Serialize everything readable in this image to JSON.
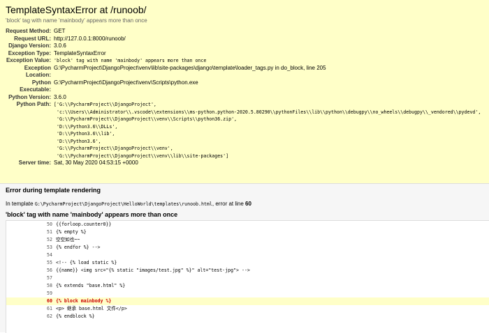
{
  "summary": {
    "title": "TemplateSyntaxError at /runoob/",
    "subtitle": "'block' tag with name 'mainbody' appears more than once",
    "rows": [
      {
        "label": "Request Method:",
        "value": "GET"
      },
      {
        "label": "Request URL:",
        "value": "http://127.0.0.1:8000/runoob/"
      },
      {
        "label": "Django Version:",
        "value": "3.0.6"
      },
      {
        "label": "Exception Type:",
        "value": "TemplateSyntaxError"
      },
      {
        "label": "Exception Value:",
        "value": "'block' tag with name 'mainbody' appears more than once"
      },
      {
        "label": "Exception Location:",
        "value": "G:\\PycharmProject\\DjangoProject\\venv\\lib\\site-packages\\django\\template\\loader_tags.py in do_block, line 205"
      },
      {
        "label": "Python Executable:",
        "value": "G:\\PycharmProject\\DjangoProject\\venv\\Scripts\\python.exe"
      },
      {
        "label": "Python Version:",
        "value": "3.6.0"
      },
      {
        "label": "Python Path:",
        "value": "['G:\\\\PycharmProject\\\\DjangoProject',\n 'c:\\\\Users\\\\Administrator\\\\.vscode\\\\extensions\\\\ms-python.python-2020.5.80290\\\\pythonFiles\\\\lib\\\\python\\\\debugpy\\\\no_wheels\\\\debugpy\\\\_vendored\\\\pydevd',\n 'G:\\\\PycharmProject\\\\DjangoProject\\\\venv\\\\Scripts\\\\python36.zip',\n 'D:\\\\Python3.6\\\\DLLs',\n 'D:\\\\Python3.6\\\\lib',\n 'D:\\\\Python3.6',\n 'G:\\\\PycharmProject\\\\DjangoProject\\\\venv',\n 'G:\\\\PycharmProject\\\\DjangoProject\\\\venv\\\\lib\\\\site-packages']"
      },
      {
        "label": "Server time:",
        "value": "Sat, 30 May 2020 04:53:15 +0000"
      }
    ]
  },
  "template": {
    "heading": "Error during template rendering",
    "location_prefix": "In template ",
    "location_path": "G:\\PycharmProject\\DjangoProject\\HelloWorld\\templates\\runoob.html",
    "location_mid": ", error at line ",
    "location_line": "60",
    "error_subheading": "'block' tag with name 'mainbody' appears more than once",
    "lines": [
      {
        "num": "50",
        "code": "{{forloop.counter0}}"
      },
      {
        "num": "51",
        "code": "{% empty %}"
      },
      {
        "num": "52",
        "code": "空空如也~~"
      },
      {
        "num": "53",
        "code": "{% endfor %} -->"
      },
      {
        "num": "54",
        "code": ""
      },
      {
        "num": "55",
        "code": "<!-- {% load static %}"
      },
      {
        "num": "56",
        "code": "{{name}} <img src=\"{% static \"images/test.jpg\" %}\" alt=\"test-jpg\"> -->"
      },
      {
        "num": "57",
        "code": ""
      },
      {
        "num": "58",
        "code": "{% extends \"base.html\" %}"
      },
      {
        "num": "59",
        "code": ""
      },
      {
        "num": "60",
        "code": "{% block mainbody %}",
        "error": true
      },
      {
        "num": "61",
        "code": "<p> 继承 base.html 文件</p>"
      },
      {
        "num": "62",
        "code": "{% endblock %}"
      }
    ]
  }
}
